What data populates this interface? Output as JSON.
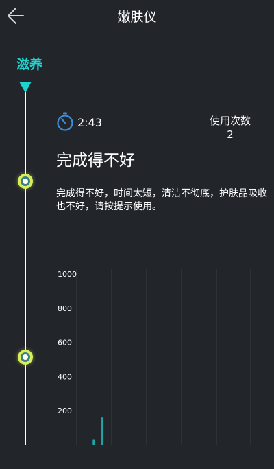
{
  "header": {
    "title": "嫩肤仪",
    "back_icon": "arrow-left-icon"
  },
  "timeline": {
    "phase_label": "滋养",
    "accent_color": "#1fd3cf",
    "node_color": "#d9ee5e"
  },
  "session": {
    "timer_icon": "stopwatch-icon",
    "duration": "2:43",
    "usage_label": "使用次数",
    "usage_count": "2"
  },
  "result": {
    "title": "完成得不好",
    "description": "完成得不好，时间太短，清洁不彻底，护肤品吸收也不好，请按提示使用。"
  },
  "chart_data": {
    "type": "bar",
    "title": "",
    "xlabel": "",
    "ylabel": "",
    "ylim": [
      0,
      1000
    ],
    "yticks": [
      200,
      400,
      600,
      800,
      1000
    ],
    "grid": true,
    "color": "#1fa5a2",
    "bars": [
      {
        "x": 0.3,
        "value": 30
      },
      {
        "x": 0.55,
        "value": 160
      }
    ]
  }
}
